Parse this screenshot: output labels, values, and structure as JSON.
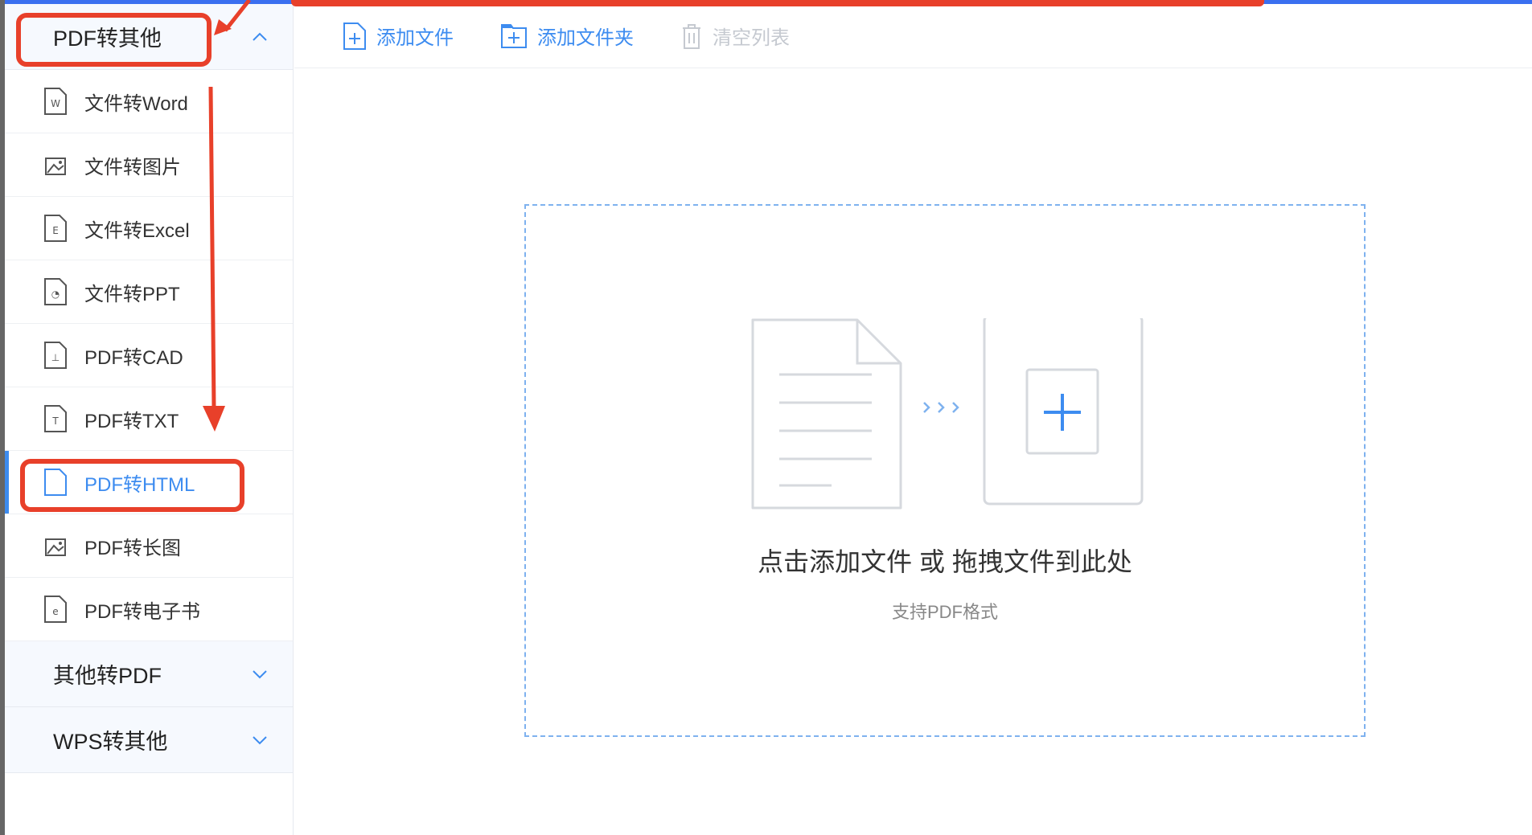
{
  "sidebar": {
    "groups": [
      {
        "label": "PDF转其他",
        "expanded": true
      },
      {
        "label": "其他转PDF",
        "expanded": false
      },
      {
        "label": "WPS转其他",
        "expanded": false
      }
    ],
    "items": [
      {
        "label": "文件转Word",
        "icon": "word-file-icon"
      },
      {
        "label": "文件转图片",
        "icon": "image-file-icon"
      },
      {
        "label": "文件转Excel",
        "icon": "excel-file-icon"
      },
      {
        "label": "文件转PPT",
        "icon": "ppt-file-icon"
      },
      {
        "label": "PDF转CAD",
        "icon": "cad-file-icon"
      },
      {
        "label": "PDF转TXT",
        "icon": "txt-file-icon"
      },
      {
        "label": "PDF转HTML",
        "icon": "html-file-icon",
        "active": true
      },
      {
        "label": "PDF转长图",
        "icon": "long-image-icon"
      },
      {
        "label": "PDF转电子书",
        "icon": "ebook-file-icon"
      }
    ]
  },
  "toolbar": {
    "add_file": "添加文件",
    "add_folder": "添加文件夹",
    "clear_list": "清空列表"
  },
  "dropzone": {
    "main": "点击添加文件 或 拖拽文件到此处",
    "sub": "支持PDF格式"
  },
  "colors": {
    "accent": "#3d8cf0",
    "annotation": "#e8402a"
  }
}
